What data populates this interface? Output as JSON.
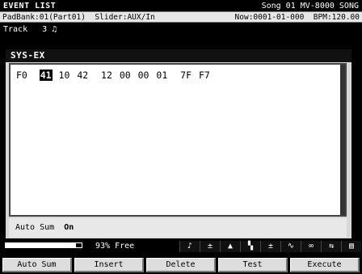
{
  "title_bar": {
    "screen": "EVENT LIST",
    "song": "Song 01 MV-8000 SONG"
  },
  "status_bar": {
    "padbank": "PadBank:01(Part01)",
    "slider": "Slider:AUX/In",
    "now": "Now:0001-01-000",
    "bpm": "BPM:120.00"
  },
  "track_bar": {
    "label": "Track",
    "number": "3",
    "icon": "music-note-icon",
    "glyph": "♫"
  },
  "sysex": {
    "title": "SYS-EX",
    "bytes": [
      "F0",
      "41",
      "10",
      "42",
      "12",
      "00",
      "00",
      "01",
      "7F",
      "F7"
    ],
    "cursor_index": 1
  },
  "auto_sum_row": {
    "label": "Auto Sum",
    "value": "On"
  },
  "footer": {
    "memory_fill_fraction": 0.93,
    "memory_free": "93% Free",
    "icons": [
      {
        "name": "note-filter-icon",
        "glyph": "♪"
      },
      {
        "name": "velocity-filter-icon",
        "glyph": "±"
      },
      {
        "name": "control-filter-icon",
        "glyph": "▲"
      },
      {
        "name": "pitch-filter-icon",
        "glyph": "▚"
      },
      {
        "name": "aftertouch-filter-icon",
        "glyph": "±"
      },
      {
        "name": "bend-filter-icon",
        "glyph": "∿"
      },
      {
        "name": "loop-filter-icon",
        "glyph": "∞"
      },
      {
        "name": "pattern-filter-icon",
        "glyph": "⇆"
      },
      {
        "name": "sysex-filter-icon",
        "glyph": "▤"
      }
    ]
  },
  "function_buttons": [
    "Auto Sum",
    "Insert",
    "Delete",
    "Test",
    "Execute"
  ]
}
